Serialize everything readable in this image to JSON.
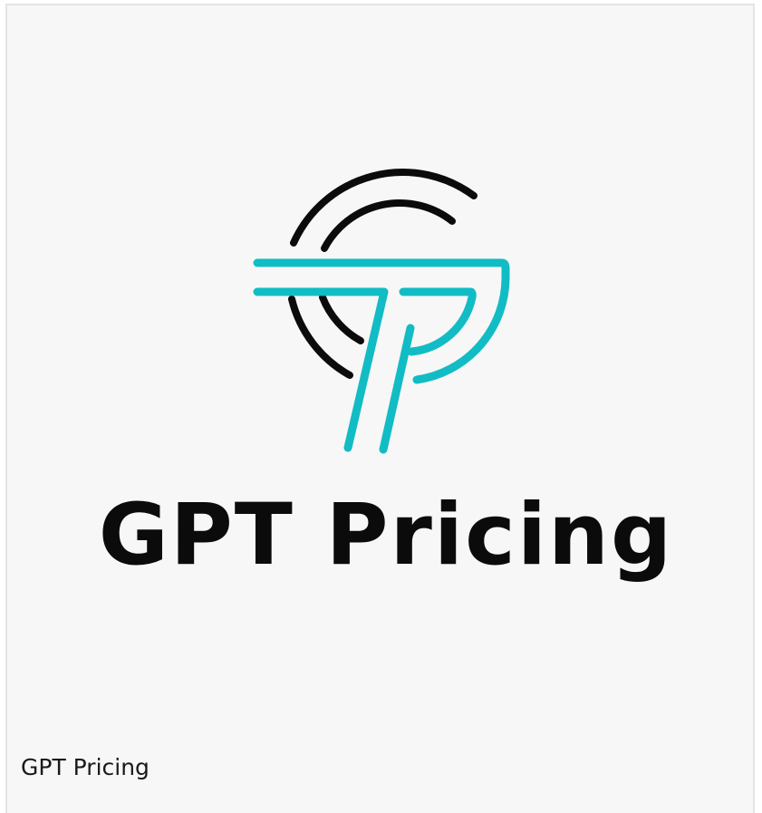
{
  "logo": {
    "wordmark": "GPT Pricing",
    "icon": "gpt-pricing-monogram-icon",
    "colors": {
      "ink": "#0b0b0b",
      "accent": "#12bcc4"
    }
  },
  "caption": {
    "text": "GPT Pricing"
  },
  "colors": {
    "card_background": "#f7f7f7",
    "card_border": "#e4e4e4"
  }
}
